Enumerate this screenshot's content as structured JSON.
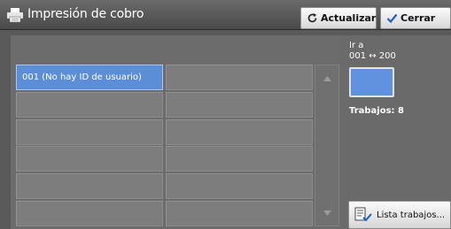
{
  "window": {
    "title": "Impresión de cobro",
    "title_icon": "printer-icon"
  },
  "toolbar": {
    "refresh_label": "Actualizar",
    "refresh_icon": "refresh-icon",
    "close_label": "Cerrar",
    "close_icon": "checkmark-icon"
  },
  "job_list": {
    "rows": [
      [
        "001  (No hay ID de usuario)",
        ""
      ],
      [
        "",
        ""
      ],
      [
        "",
        ""
      ],
      [
        "",
        ""
      ],
      [
        "",
        ""
      ],
      [
        "",
        ""
      ]
    ],
    "selected_index": 0
  },
  "goto": {
    "label": "Ir a",
    "range": "001 ↔ 200",
    "value": ""
  },
  "jobs": {
    "count_text": "Trabajos: 8"
  },
  "job_list_button": {
    "label": "Lista trabajos...",
    "icon": "document-list-icon"
  },
  "colors": {
    "selection_blue": "#5c8ed8",
    "background_gray": "#5a5a5a"
  }
}
